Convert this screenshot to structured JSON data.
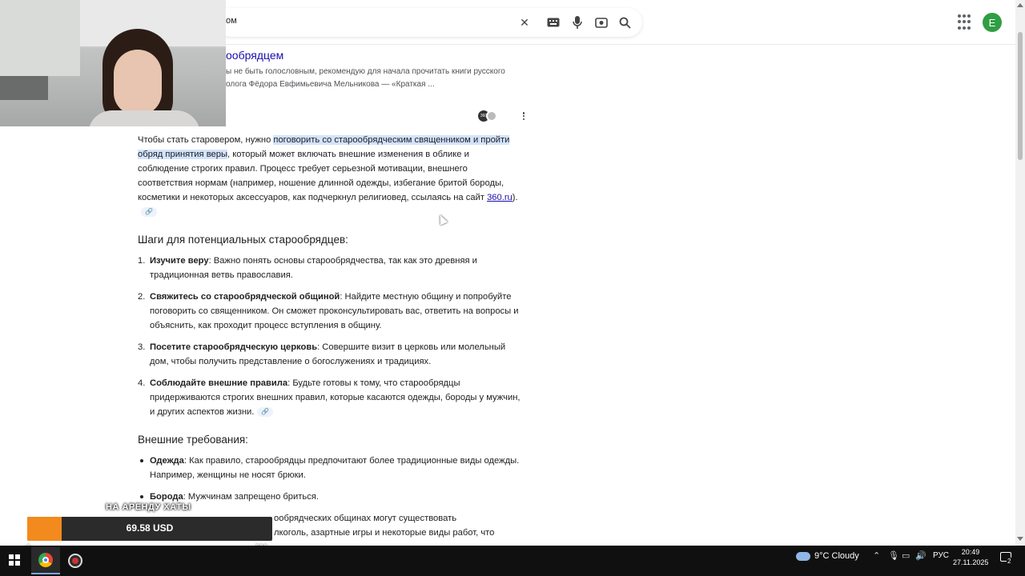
{
  "search": {
    "query_fragment": "ом"
  },
  "header": {
    "avatar_letter": "E"
  },
  "partial_result": {
    "title_fragment": "ообрядцем",
    "snippet_line1": "ы не быть голословным, рекомендую для начала прочитать книги русского",
    "snippet_line2": "олога Фёдора Евфимьевича Мельникова — «Краткая ..."
  },
  "ai_overview": {
    "intro_before": "Чтобы стать старовером, нужно ",
    "intro_highlight": "поговорить со старообрядческим священником и пройти обряд принятия веры",
    "intro_after": ", который может включать внешние изменения в облике и соблюдение строгих правил. Процесс требует серьезной мотивации, внешнего соответствия нормам (например, ношение длинной одежды, избегание бритой бороды, косметики и некоторых аксессуаров, как подчеркнул религиовед, ссылаясь на сайт ",
    "intro_link": "360.ru",
    "intro_end": ").",
    "steps_heading": "Шаги для потенциальных старообрядцев:",
    "steps": [
      {
        "num": "1.",
        "title": "Изучите веру",
        "text": ": Важно понять основы старообрядчества, так как это древняя и традиционная ветвь православия."
      },
      {
        "num": "2.",
        "title": "Свяжитесь со старообрядческой общиной",
        "text": ": Найдите местную общину и попробуйте поговорить со священником. Он сможет проконсультировать вас, ответить на вопросы и объяснить, как проходит процесс вступления в общину."
      },
      {
        "num": "3.",
        "title": "Посетите старообрядческую церковь",
        "text": ": Совершите визит в церковь или молельный дом, чтобы получить представление о богослужениях и традициях."
      },
      {
        "num": "4.",
        "title": "Соблюдайте внешние правила",
        "text": ": Будьте готовы к тому, что старообрядцы придерживаются строгих внешних правил, которые касаются одежды, бороды у мужчин, и других аспектов жизни."
      }
    ],
    "req_heading": "Внешние требования:",
    "requirements": [
      {
        "title": "Одежда",
        "text": ": Как правило, старообрядцы предпочитают более традиционные виды одежды. Например, женщины не носят брюки."
      },
      {
        "title": "Борода",
        "text": ": Мужчинам запрещено бриться."
      },
      {
        "title": "",
        "text": "ообрядческих общинах могут существовать"
      },
      {
        "title": "",
        "text": "лкоголь, азартные игры и некоторые виды работ, что"
      }
    ]
  },
  "donation": {
    "label": "НА АРЕНДУ ХАТЫ",
    "amount": "69.58 USD",
    "min": "0",
    "max": "500",
    "progress_fraction": 0.139,
    "fill_color": "#f28a1e"
  },
  "taskbar": {
    "weather": "9°C  Cloudy",
    "language": "РУС",
    "time": "20:49",
    "date": "27.11.2025",
    "notification_count": "2"
  }
}
